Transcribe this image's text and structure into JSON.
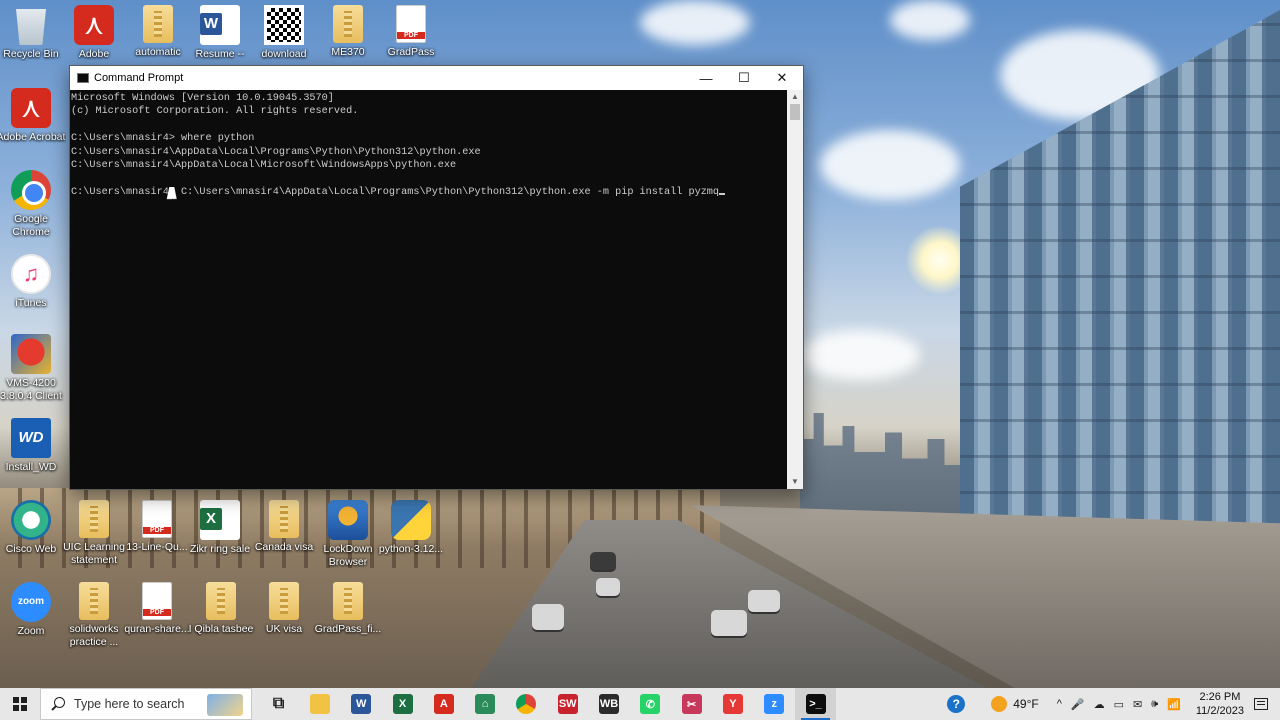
{
  "desktop": {
    "icons": [
      {
        "label": "Recycle Bin",
        "icon": "recycle-bin-icon"
      },
      {
        "label": "Adobe",
        "icon": "adobe-acrobat-icon"
      },
      {
        "label": "automatic",
        "icon": "zip-folder-icon"
      },
      {
        "label": "Resume --",
        "icon": "word-document-icon"
      },
      {
        "label": "download",
        "icon": "qr-code-icon"
      },
      {
        "label": "ME370",
        "icon": "zip-folder-icon"
      },
      {
        "label": "GradPass",
        "icon": "pdf-file-icon"
      },
      {
        "label": "Adobe Acrobat",
        "icon": "adobe-acrobat-icon"
      },
      {
        "label": "Google Chrome",
        "icon": "chrome-icon"
      },
      {
        "label": "iTunes",
        "icon": "itunes-icon"
      },
      {
        "label": "VMS-4200 3.8.0.4 Client",
        "icon": "vms-client-icon"
      },
      {
        "label": "Install_WD",
        "icon": "wd-install-icon"
      },
      {
        "label": "Cisco Web",
        "icon": "cisco-webex-icon"
      },
      {
        "label": "UIC Learning statement",
        "icon": "zip-folder-icon"
      },
      {
        "label": "13-Line-Qu...",
        "icon": "pdf-file-icon"
      },
      {
        "label": "Zikr ring sale",
        "icon": "excel-sheet-icon"
      },
      {
        "label": "Canada visa",
        "icon": "zip-folder-icon"
      },
      {
        "label": "LockDown Browser",
        "icon": "lockdown-browser-icon"
      },
      {
        "label": "python-3.12...",
        "icon": "python-installer-icon"
      },
      {
        "label": "Zoom",
        "icon": "zoom-icon"
      },
      {
        "label": "solidworks practice ...",
        "icon": "zip-folder-icon"
      },
      {
        "label": "quran-share...",
        "icon": "pdf-file-icon"
      },
      {
        "label": "I Qibla tasbee",
        "icon": "zip-folder-icon"
      },
      {
        "label": "UK visa",
        "icon": "zip-folder-icon"
      },
      {
        "label": "GradPass_fi...",
        "icon": "zip-folder-icon"
      }
    ]
  },
  "cmd_window": {
    "title": "Command Prompt",
    "lines": [
      "Microsoft Windows [Version 10.0.19045.3570]",
      "(c) Microsoft Corporation. All rights reserved.",
      "",
      "C:\\Users\\mnasir4> where python",
      "C:\\Users\\mnasir4\\AppData\\Local\\Programs\\Python\\Python312\\python.exe",
      "C:\\Users\\mnasir4\\AppData\\Local\\Microsoft\\WindowsApps\\python.exe",
      "",
      "C:\\Users\\mnasir4> C:\\Users\\mnasir4\\AppData\\Local\\Programs\\Python\\Python312\\python.exe -m pip install pyzmq"
    ],
    "minimize_glyph": "—",
    "maximize_glyph": "☐",
    "close_glyph": "✕",
    "scroll_up_glyph": "▲",
    "scroll_down_glyph": "▼"
  },
  "taskbar": {
    "search_placeholder": "Type here to search",
    "pinned": [
      {
        "name": "task-view",
        "label": "⧉",
        "color": "#3a3a3a"
      },
      {
        "name": "file-explorer",
        "label": "",
        "color": "#f2c244"
      },
      {
        "name": "word",
        "label": "W",
        "color": "#2b579a"
      },
      {
        "name": "excel",
        "label": "X",
        "color": "#1d6f42"
      },
      {
        "name": "acrobat",
        "label": "A",
        "color": "#d42b1e"
      },
      {
        "name": "app-store-home",
        "label": "⌂",
        "color": "#2a8a5a"
      },
      {
        "name": "chrome",
        "label": "",
        "color": "#db4437"
      },
      {
        "name": "solidworks",
        "label": "SW",
        "color": "#c8232c"
      },
      {
        "name": "wb-app",
        "label": "WB",
        "color": "#2b2b2b"
      },
      {
        "name": "whatsapp",
        "label": "✆",
        "color": "#25d366"
      },
      {
        "name": "snipping-tool",
        "label": "✂",
        "color": "#c8385a"
      },
      {
        "name": "yandex-browser",
        "label": "Y",
        "color": "#e53935"
      },
      {
        "name": "zoom",
        "label": "z",
        "color": "#2d8cff"
      },
      {
        "name": "command-prompt",
        "label": ">_",
        "color": "#0c0c0c"
      }
    ],
    "active_app": "command-prompt",
    "tray": {
      "help_glyph": "?",
      "temperature": "49°F",
      "tray_glyphs": [
        "^",
        "🎤",
        "☁",
        "▭",
        "✉",
        "🕪",
        "📶"
      ],
      "time": "2:26 PM",
      "date": "11/2/2023"
    }
  }
}
